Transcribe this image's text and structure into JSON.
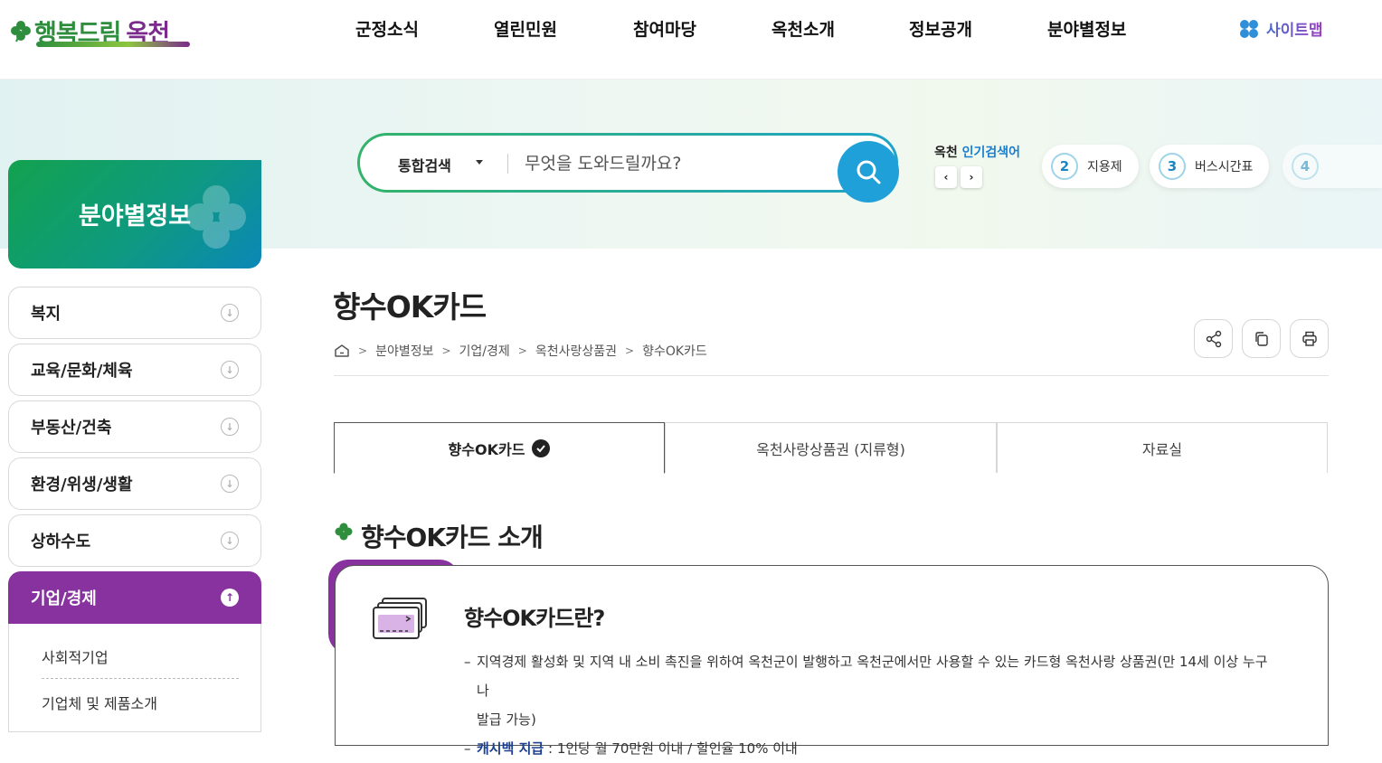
{
  "header": {
    "logo_text_a": "행복드림",
    "logo_text_b": "옥천",
    "nav": [
      "군정소식",
      "열린민원",
      "참여마당",
      "옥천소개",
      "정보공개",
      "분야별정보"
    ],
    "sitemap_label": "사이트맵"
  },
  "search": {
    "category": "통합검색",
    "placeholder": "무엇을 도와드릴까요?",
    "popular_prefix": "옥천",
    "popular_label": "인기검색어",
    "prev_symbol": "‹",
    "next_symbol": "›",
    "keywords": [
      {
        "num": "2",
        "text": "지용제"
      },
      {
        "num": "3",
        "text": "버스시간표"
      },
      {
        "num": "4",
        "text": ""
      }
    ]
  },
  "sidebar": {
    "title": "분야별정보",
    "items": [
      {
        "label": "복지"
      },
      {
        "label": "교육/문화/체육"
      },
      {
        "label": "부동산/건축"
      },
      {
        "label": "환경/위생/생활"
      },
      {
        "label": "상하수도"
      },
      {
        "label": "기업/경제"
      }
    ],
    "active_index": 5,
    "sub_items": [
      "사회적기업",
      "기업체 및 제품소개"
    ]
  },
  "main": {
    "page_title": "향수OK카드",
    "breadcrumb": [
      "분야별정보",
      "기업/경제",
      "옥천사랑상품권",
      "향수OK카드"
    ],
    "tabs": [
      {
        "label": "향수OK카드",
        "active": true
      },
      {
        "label": "옥천사랑상품권 (지류형)",
        "active": false
      },
      {
        "label": "자료실",
        "active": false
      }
    ],
    "section_title": "향수OK카드 소개",
    "card_title": "향수OK카드란?",
    "card_line1": "지역경제 활성화 및 지역 내 소비 촉진을 위하여 옥천군이 발행하고 옥천군에서만 사용할 수 있는 카드형 옥천사랑 상품권(만 14세 이상 누구나",
    "card_line1b": "발급 가능)",
    "card_line2_strong": "캐시백 지급",
    "card_line2_rest": " : 1인당 월 70만원 이내 / 할인율 10% 이내"
  },
  "colors": {
    "accent_purple": "#87329e",
    "search_blue": "#1fa0d8",
    "green": "#13a24f"
  }
}
